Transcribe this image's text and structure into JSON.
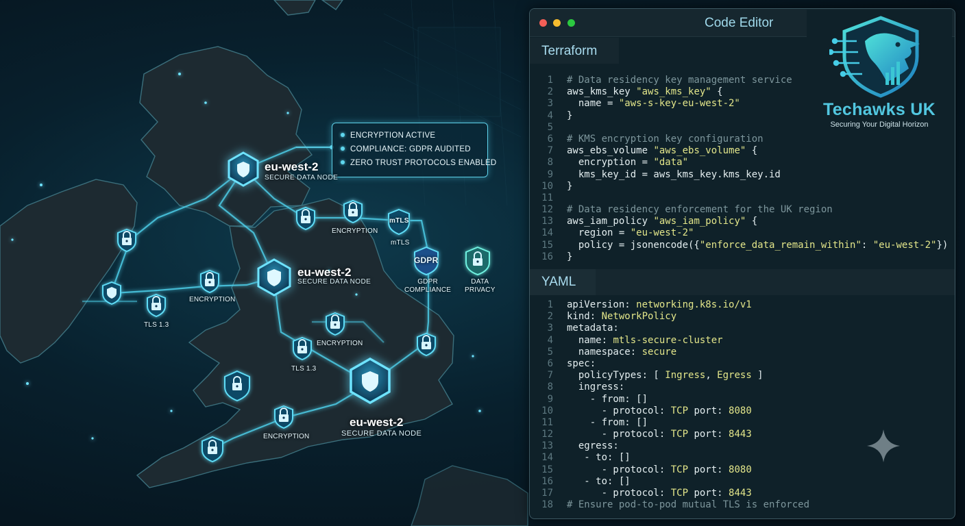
{
  "status_panel": {
    "items": [
      "ENCRYPTION ACTIVE",
      "COMPLIANCE: GDPR AUDITED",
      "ZERO TRUST PROTOCOLS ENABLED"
    ]
  },
  "nodes": [
    {
      "title": "eu-west-2",
      "subtitle": "SECURE DATA NODE"
    },
    {
      "title": "eu-west-2",
      "subtitle": "SECURE DATA NODE"
    },
    {
      "title": "eu-west-2",
      "subtitle": "SECURE DATA NODE"
    }
  ],
  "map_labels": {
    "encryption_1": "ENCRYPTION",
    "mtls_inner": "mTLS",
    "mtls_below": "mTLS",
    "gdpr_inner": "GDPR",
    "gdpr_label": "GDPR\nCOMPLIANCE",
    "data_privacy": "DATA\nPRIVACY",
    "encryption_2": "ENCRYPTION",
    "tls_1": "TLS 1.3",
    "encryption_3": "ENCRYPTION",
    "tls_2": "TLS 1.3",
    "encryption_4": "ENCRYPTION"
  },
  "editor": {
    "title": "Code Editor",
    "terraform_tab": "Terraform",
    "yaml_tab": "YAML",
    "terraform_lines": [
      [
        {
          "t": "c",
          "v": "# Data residency key management service"
        }
      ],
      [
        {
          "t": "p",
          "v": "aws_kms_key "
        },
        {
          "t": "s",
          "v": "\"aws_kms_key\""
        },
        {
          "t": "p",
          "v": " {"
        }
      ],
      [
        {
          "t": "p",
          "v": "  name = "
        },
        {
          "t": "s",
          "v": "\"aws-s-key-eu-west-2\""
        }
      ],
      [
        {
          "t": "p",
          "v": "}"
        }
      ],
      [],
      [
        {
          "t": "c",
          "v": "# KMS encryption key configuration"
        }
      ],
      [
        {
          "t": "p",
          "v": "aws_ebs_volume "
        },
        {
          "t": "s",
          "v": "\"aws_ebs_volume\""
        },
        {
          "t": "p",
          "v": " {"
        }
      ],
      [
        {
          "t": "p",
          "v": "  encryption = "
        },
        {
          "t": "s",
          "v": "\"data\""
        }
      ],
      [
        {
          "t": "p",
          "v": "  kms_key_id = aws_kms_key.kms_key.id"
        }
      ],
      [
        {
          "t": "p",
          "v": "}"
        }
      ],
      [],
      [
        {
          "t": "c",
          "v": "# Data residency enforcement for the UK region"
        }
      ],
      [
        {
          "t": "p",
          "v": "aws_iam_policy "
        },
        {
          "t": "s",
          "v": "\"aws_iam_policy\""
        },
        {
          "t": "p",
          "v": " {"
        }
      ],
      [
        {
          "t": "p",
          "v": "  region = "
        },
        {
          "t": "s",
          "v": "\"eu-west-2\""
        }
      ],
      [
        {
          "t": "p",
          "v": "  policy = jsonencode({"
        },
        {
          "t": "s",
          "v": "\"enforce_data_remain_within\""
        },
        {
          "t": "p",
          "v": ": "
        },
        {
          "t": "s",
          "v": "\"eu-west-2\""
        },
        {
          "t": "p",
          "v": "})"
        }
      ],
      [
        {
          "t": "p",
          "v": "}"
        }
      ]
    ],
    "yaml_lines": [
      [
        {
          "t": "p",
          "v": "apiVersion: "
        },
        {
          "t": "s",
          "v": "networking.k8s.io/v1"
        }
      ],
      [
        {
          "t": "p",
          "v": "kind: "
        },
        {
          "t": "s",
          "v": "NetworkPolicy"
        }
      ],
      [
        {
          "t": "p",
          "v": "metadata:"
        }
      ],
      [
        {
          "t": "p",
          "v": "  name: "
        },
        {
          "t": "s",
          "v": "mtls-secure-cluster"
        }
      ],
      [
        {
          "t": "p",
          "v": "  namespace: "
        },
        {
          "t": "s",
          "v": "secure"
        }
      ],
      [
        {
          "t": "p",
          "v": "spec:"
        }
      ],
      [
        {
          "t": "p",
          "v": "  policyTypes: [ "
        },
        {
          "t": "s",
          "v": "Ingress"
        },
        {
          "t": "p",
          "v": ", "
        },
        {
          "t": "s",
          "v": "Egress"
        },
        {
          "t": "p",
          "v": " ]"
        }
      ],
      [
        {
          "t": "p",
          "v": "  ingress:"
        }
      ],
      [
        {
          "t": "p",
          "v": "    - from: []"
        }
      ],
      [
        {
          "t": "p",
          "v": "      - protocol: "
        },
        {
          "t": "s",
          "v": "TCP"
        },
        {
          "t": "p",
          "v": " port: "
        },
        {
          "t": "s",
          "v": "8080"
        }
      ],
      [
        {
          "t": "p",
          "v": "    - from: []"
        }
      ],
      [
        {
          "t": "p",
          "v": "      - protocol: "
        },
        {
          "t": "s",
          "v": "TCP"
        },
        {
          "t": "p",
          "v": " port: "
        },
        {
          "t": "s",
          "v": "8443"
        }
      ],
      [
        {
          "t": "p",
          "v": "  egress:"
        }
      ],
      [
        {
          "t": "p",
          "v": "   - to: []"
        }
      ],
      [
        {
          "t": "p",
          "v": "      - protocol: "
        },
        {
          "t": "s",
          "v": "TCP"
        },
        {
          "t": "p",
          "v": " port: "
        },
        {
          "t": "s",
          "v": "8080"
        }
      ],
      [
        {
          "t": "p",
          "v": "   - to: []"
        }
      ],
      [
        {
          "t": "p",
          "v": "      - protocol: "
        },
        {
          "t": "s",
          "v": "TCP"
        },
        {
          "t": "p",
          "v": " port: "
        },
        {
          "t": "s",
          "v": "8443"
        }
      ],
      [
        {
          "t": "c",
          "v": "# Ensure pod-to-pod mutual TLS is enforced"
        }
      ]
    ]
  },
  "logo": {
    "name": "Techawks UK",
    "tagline": "Securing Your Digital Horizon"
  },
  "colors": {
    "accent": "#4fd3ee",
    "background": "#071722",
    "editor_bg": "#0f2129",
    "string": "#e3e68a",
    "comment": "#7d969c"
  },
  "icons": [
    "shield-icon",
    "lock-icon",
    "sparkle-icon",
    "hawk-logo-icon"
  ]
}
